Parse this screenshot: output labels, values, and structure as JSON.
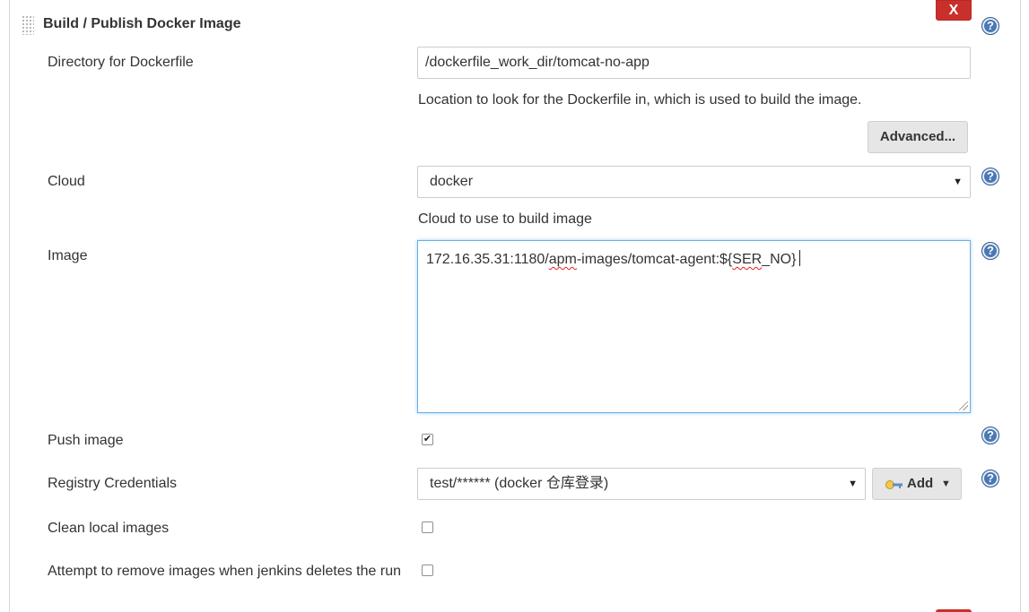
{
  "section": {
    "title": "Build / Publish Docker Image",
    "close_label": "X",
    "help_label": "?"
  },
  "dockerfile": {
    "label": "Directory for Dockerfile",
    "value": "/dockerfile_work_dir/tomcat-no-app",
    "description": "Location to look for the Dockerfile in, which is used to build the image.",
    "advanced_label": "Advanced..."
  },
  "cloud": {
    "label": "Cloud",
    "selected": "docker",
    "description": "Cloud to use to build image"
  },
  "image": {
    "label": "Image",
    "value_prefix": "172.16.35.31:1180/",
    "value_misspelled_1": "apm",
    "value_middle": "-images/tomcat-agent:${",
    "value_misspelled_2": "SER",
    "value_suffix": "_NO}"
  },
  "push_image": {
    "label": "Push image",
    "checked": true
  },
  "registry_credentials": {
    "label": "Registry Credentials",
    "selected": "test/****** (docker 仓库登录)",
    "add_label": "Add"
  },
  "clean_local_images": {
    "label": "Clean local images",
    "checked": false
  },
  "remove_on_delete": {
    "label": "Attempt to remove images when jenkins deletes the run",
    "checked": false
  },
  "colors": {
    "help_icon": "#4a78b4",
    "close_button": "#c9302c",
    "focus_border": "#66afe9"
  }
}
